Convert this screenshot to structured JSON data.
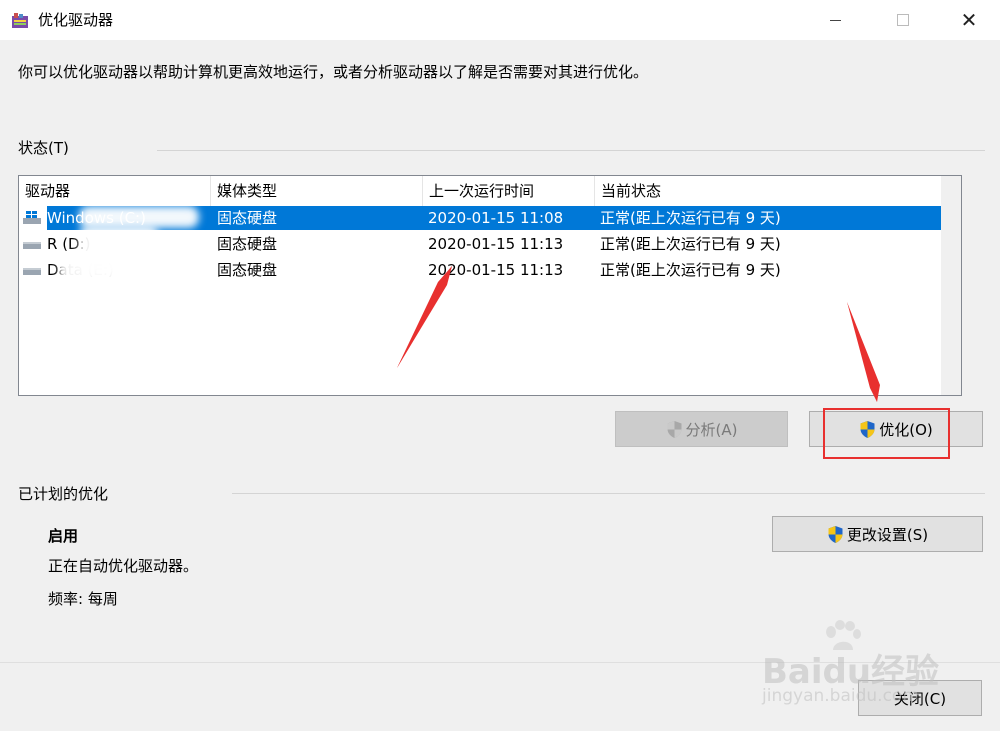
{
  "window": {
    "title": "优化驱动器"
  },
  "description": "你可以优化驱动器以帮助计算机更高效地运行，或者分析驱动器以了解是否需要对其进行优化。",
  "status": {
    "label": "状态(T)",
    "columns": [
      "驱动器",
      "媒体类型",
      "上一次运行时间",
      "当前状态"
    ],
    "rows": [
      {
        "drive": "Windows (C:)",
        "media": "固态硬盘",
        "last_run": "2020-01-15 11:08",
        "state": "正常(距上次运行已有 9 天)",
        "selected": true
      },
      {
        "drive": "R (D:)",
        "media": "固态硬盘",
        "last_run": "2020-01-15 11:13",
        "state": "正常(距上次运行已有 9 天)",
        "selected": false
      },
      {
        "drive": "Data (E:)",
        "media": "固态硬盘",
        "last_run": "2020-01-15 11:13",
        "state": "正常(距上次运行已有 9 天)",
        "selected": false
      }
    ],
    "analyze_button": "分析(A)",
    "optimize_button": "优化(O)"
  },
  "scheduled": {
    "label": "已计划的优化",
    "state": "启用",
    "detail": "正在自动优化驱动器。",
    "frequency": "频率: 每周",
    "change_button": "更改设置(S)"
  },
  "footer": {
    "close_button": "关闭(C)"
  },
  "watermark": {
    "brand": "Baidu经验",
    "url": "jingyan.baidu.com"
  },
  "colors": {
    "selection": "#0078d7",
    "annotation": "#e8302f"
  },
  "icons": {
    "app": "defrag-app-icon",
    "drive": "drive-icon",
    "shield": "uac-shield-icon"
  }
}
